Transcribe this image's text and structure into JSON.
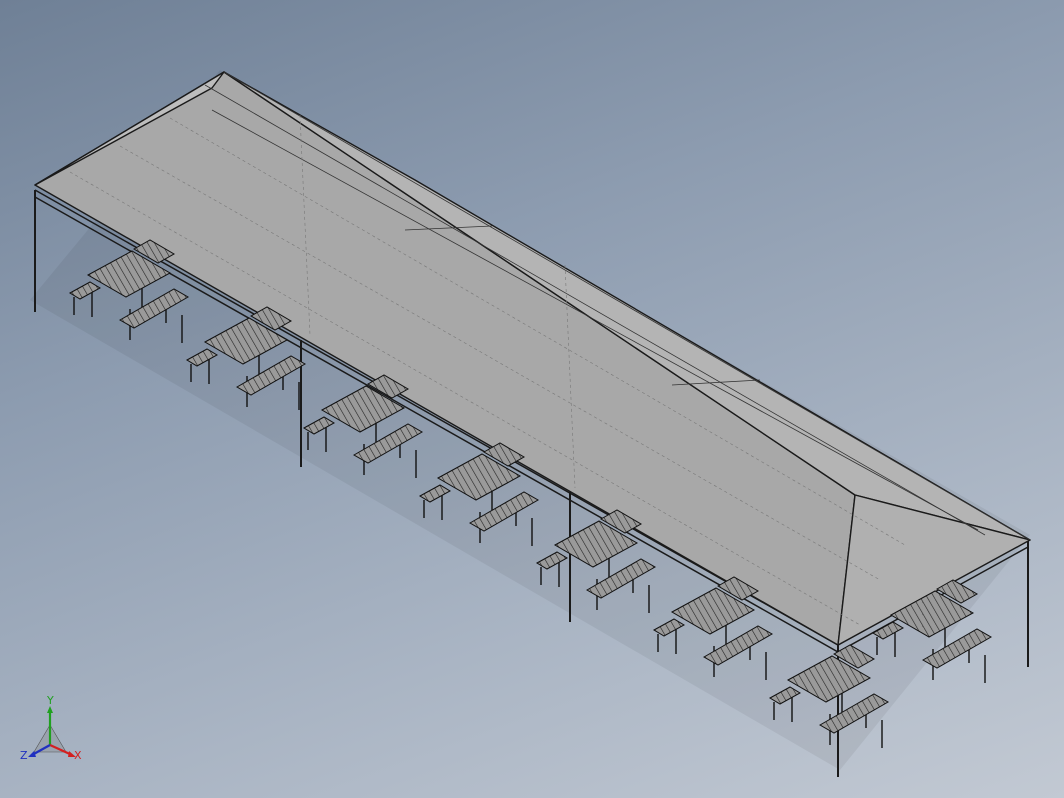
{
  "viewport": {
    "background_top": "#6f8096",
    "background_bottom": "#c2c9d3"
  },
  "model": {
    "roof_color": "#a8a8a8",
    "edge_color": "#111111",
    "table_count": 8
  },
  "triad": {
    "x_label": "X",
    "y_label": "Y",
    "z_label": "Z",
    "x_color": "#d42020",
    "y_color": "#20a020",
    "z_color": "#2030c0"
  }
}
